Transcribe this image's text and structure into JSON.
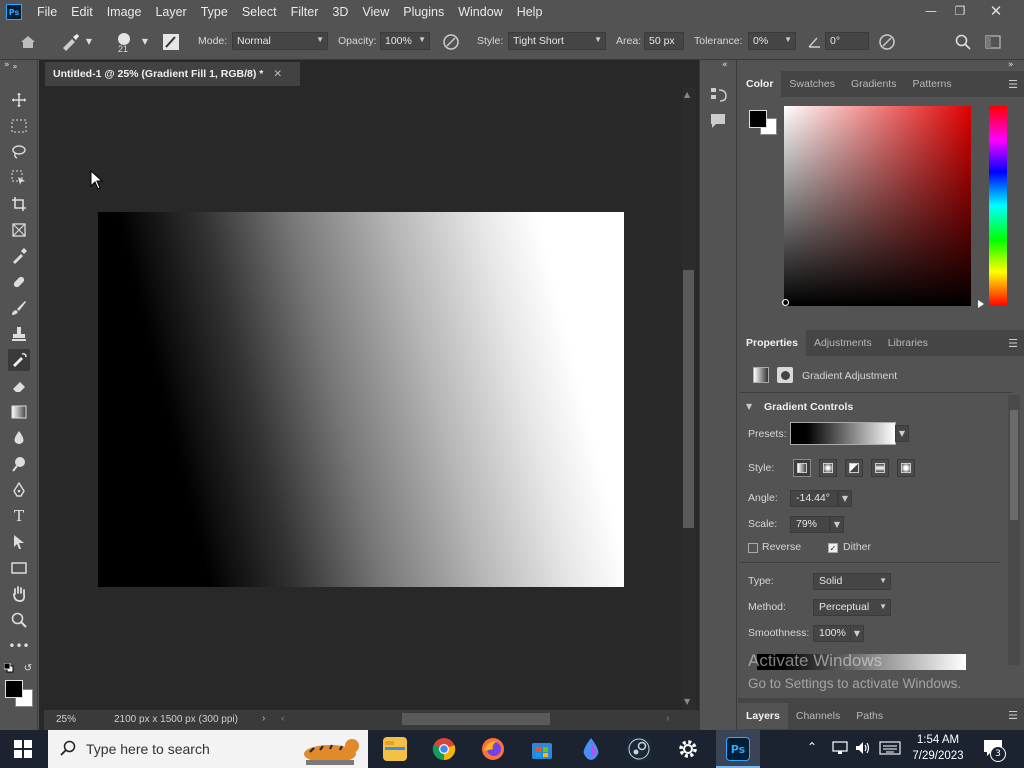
{
  "app": {
    "logo_text": "Ps"
  },
  "menu": [
    "File",
    "Edit",
    "Image",
    "Layer",
    "Type",
    "Select",
    "Filter",
    "3D",
    "View",
    "Plugins",
    "Window",
    "Help"
  ],
  "options_bar": {
    "brush_size": "21",
    "mode_label": "Mode:",
    "mode_value": "Normal",
    "opacity_label": "Opacity:",
    "opacity_value": "100%",
    "style_label": "Style:",
    "style_value": "Tight Short",
    "area_label": "Area:",
    "area_value": "50 px",
    "tolerance_label": "Tolerance:",
    "tolerance_value": "0%",
    "angle_value": "0°"
  },
  "document": {
    "tab_title": "Untitled-1 @ 25% (Gradient Fill 1, RGB/8) *",
    "zoom": "25%",
    "dimensions": "2100 px x 1500 px (300 ppi)"
  },
  "color_panel": {
    "tabs": [
      "Color",
      "Swatches",
      "Gradients",
      "Patterns"
    ],
    "foreground": "#000000",
    "background": "#ffffff"
  },
  "properties_panel": {
    "tabs": [
      "Properties",
      "Adjustments",
      "Libraries"
    ],
    "layer_type": "Gradient Adjustment",
    "section_title": "Gradient Controls",
    "presets_label": "Presets:",
    "style_label": "Style:",
    "angle_label": "Angle:",
    "angle_value": "-14.44°",
    "scale_label": "Scale:",
    "scale_value": "79%",
    "reverse_label": "Reverse",
    "reverse_checked": false,
    "dither_label": "Dither",
    "dither_checked": true,
    "type_label": "Type:",
    "type_value": "Solid",
    "method_label": "Method:",
    "method_value": "Perceptual",
    "smoothness_label": "Smoothness:",
    "smoothness_value": "100%"
  },
  "layers_panel": {
    "tabs": [
      "Layers",
      "Channels",
      "Paths"
    ]
  },
  "watermark": {
    "line1": "Activate Windows",
    "line2": "Go to Settings to activate Windows."
  },
  "taskbar": {
    "search_placeholder": "Type here to search",
    "time": "1:54 AM",
    "date": "7/29/2023",
    "notification_count": "3"
  }
}
